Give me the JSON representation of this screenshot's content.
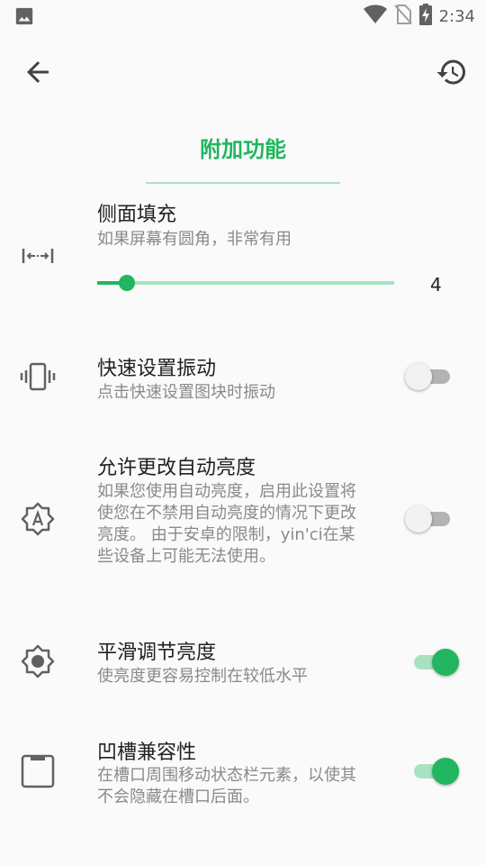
{
  "status_bar": {
    "time": "2:34",
    "icons": [
      "image-icon",
      "wifi-icon",
      "no-sim-icon",
      "battery-charging-icon"
    ]
  },
  "app_bar": {
    "back_icon": "arrow-back-icon",
    "reset_icon": "restore-icon"
  },
  "page": {
    "title": "附加功能"
  },
  "settings": {
    "side_padding": {
      "title": "侧面填充",
      "desc": "如果屏幕有圆角，非常有用",
      "icon": "horizontal-padding-icon",
      "slider_value": "4",
      "slider_fraction": 0.1
    },
    "qs_vibration": {
      "title": "快速设置振动",
      "desc": "点击快速设置图块时振动",
      "icon": "vibration-icon",
      "enabled": false
    },
    "auto_brightness": {
      "title": "允许更改自动亮度",
      "desc": "如果您使用自动亮度，启用此设置将使您在不禁用自动亮度的情况下更改亮度。 由于安卓的限制，yin'ci在某些设备上可能无法使用。",
      "icon": "brightness-auto-icon",
      "enabled": false
    },
    "smooth_brightness": {
      "title": "平滑调节亮度",
      "desc": "使亮度更容易控制在较低水平",
      "icon": "brightness-icon",
      "enabled": true
    },
    "notch_compat": {
      "title": "凹槽兼容性",
      "desc": "在槽口周围移动状态栏元素，以使其不会隐藏在槽口后面。",
      "icon": "notch-icon",
      "enabled": true
    }
  },
  "colors": {
    "accent": "#21b65f",
    "accent_light": "#a8e2c1",
    "text_secondary": "#8a8a8a",
    "icon": "#616161"
  }
}
